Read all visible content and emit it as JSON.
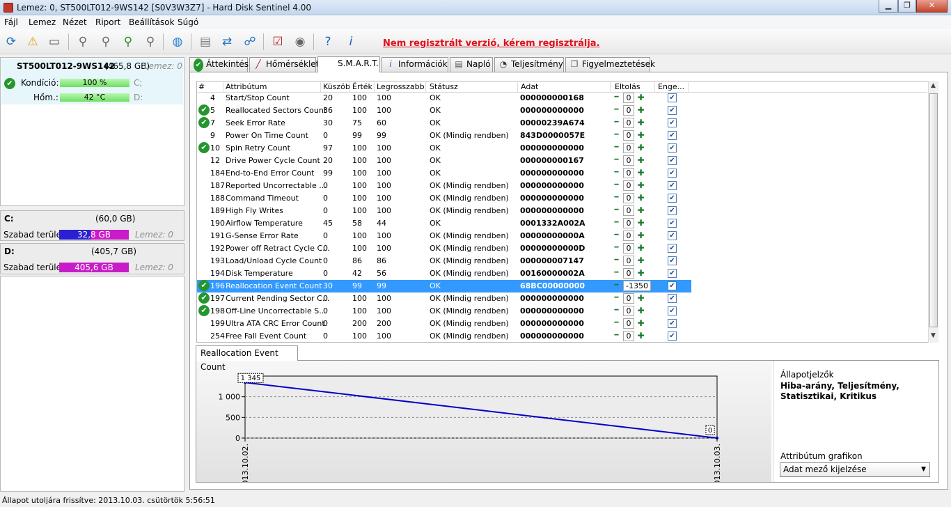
{
  "window": {
    "title": "Lemez: 0, ST500LT012-9WS142 [S0V3W3Z7]  -  Hard Disk Sentinel 4.00",
    "min": "▁",
    "max": "❐",
    "close": "✕"
  },
  "menu": [
    "Fájl",
    "Lemez",
    "Nézet",
    "Riport",
    "Beállítások",
    "Súgó"
  ],
  "toolbar": {
    "icons": [
      "refresh-icon",
      "warning-icon",
      "disk-icon",
      "satellite-dish-icon",
      "satellite-dish-icon",
      "satellite-dish-check-icon",
      "satellite-dish-tools-icon",
      "globe-icon",
      "document-icon",
      "disk-transfer-icon",
      "network-icon",
      "checklist-icon",
      "speaker-icon",
      "help-icon",
      "info-icon"
    ],
    "register_msg": "Nem regisztrált verzió, kérem regisztrálja."
  },
  "disk": {
    "name": "ST500LT012-9WS142",
    "size": "(465,8 GB)",
    "disk_label": "Lemez: 0",
    "health_label": "Kondíció:",
    "health_value": "100 %",
    "health_pct": 100,
    "health_drive": "C;",
    "temp_label": "Hőm.:",
    "temp_value": "42 °C",
    "temp_drive": "D:"
  },
  "partitions": [
    {
      "letter": "C:",
      "size": "(60,0 GB)",
      "free_label": "Szabad terület",
      "free_value": "32,8 GB",
      "disk_label": "Lemez: 0",
      "free_color": "#2a1fd1"
    },
    {
      "letter": "D:",
      "size": "(405,7 GB)",
      "free_label": "Szabad terület",
      "free_value": "405,6 GB",
      "disk_label": "Lemez: 0",
      "free_color": "#c81cc8"
    }
  ],
  "tabs": [
    {
      "label": "Áttekintés",
      "icon": "check-icon"
    },
    {
      "label": "Hőmérséklet",
      "icon": "thermometer-icon"
    },
    {
      "label": "S.M.A.R.T.",
      "icon": ""
    },
    {
      "label": "Információk",
      "icon": "info-icon"
    },
    {
      "label": "Napló",
      "icon": "log-icon"
    },
    {
      "label": "Teljesítmény",
      "icon": "gauge-icon"
    },
    {
      "label": "Figyelmeztetések",
      "icon": "alerts-icon"
    }
  ],
  "smart_columns": [
    "#",
    "Attribútum",
    "Küszöb",
    "Érték",
    "Legrosszabb",
    "Státusz",
    "Adat",
    "Eltolás",
    "Enge..."
  ],
  "smart_rows": [
    {
      "ok": false,
      "id": "4",
      "attr": "Start/Stop Count",
      "thr": "20",
      "val": "100",
      "worst": "100",
      "status": "OK",
      "data": "000000000168",
      "offset": "0"
    },
    {
      "ok": true,
      "id": "5",
      "attr": "Reallocated Sectors Count",
      "thr": "36",
      "val": "100",
      "worst": "100",
      "status": "OK",
      "data": "000000000000",
      "offset": "0"
    },
    {
      "ok": true,
      "id": "7",
      "attr": "Seek Error Rate",
      "thr": "30",
      "val": "75",
      "worst": "60",
      "status": "OK",
      "data": "00000239A674",
      "offset": "0"
    },
    {
      "ok": false,
      "id": "9",
      "attr": "Power On Time Count",
      "thr": "0",
      "val": "99",
      "worst": "99",
      "status": "OK (Mindig rendben)",
      "data": "843D0000057E",
      "offset": "0"
    },
    {
      "ok": true,
      "id": "10",
      "attr": "Spin Retry Count",
      "thr": "97",
      "val": "100",
      "worst": "100",
      "status": "OK",
      "data": "000000000000",
      "offset": "0"
    },
    {
      "ok": false,
      "id": "12",
      "attr": "Drive Power Cycle Count",
      "thr": "20",
      "val": "100",
      "worst": "100",
      "status": "OK",
      "data": "000000000167",
      "offset": "0"
    },
    {
      "ok": false,
      "id": "184",
      "attr": "End-to-End Error Count",
      "thr": "99",
      "val": "100",
      "worst": "100",
      "status": "OK",
      "data": "000000000000",
      "offset": "0"
    },
    {
      "ok": false,
      "id": "187",
      "attr": "Reported Uncorrectable ...",
      "thr": "0",
      "val": "100",
      "worst": "100",
      "status": "OK (Mindig rendben)",
      "data": "000000000000",
      "offset": "0"
    },
    {
      "ok": false,
      "id": "188",
      "attr": "Command Timeout",
      "thr": "0",
      "val": "100",
      "worst": "100",
      "status": "OK (Mindig rendben)",
      "data": "000000000000",
      "offset": "0"
    },
    {
      "ok": false,
      "id": "189",
      "attr": "High Fly Writes",
      "thr": "0",
      "val": "100",
      "worst": "100",
      "status": "OK (Mindig rendben)",
      "data": "000000000000",
      "offset": "0"
    },
    {
      "ok": false,
      "id": "190",
      "attr": "Airflow Temperature",
      "thr": "45",
      "val": "58",
      "worst": "44",
      "status": "OK",
      "data": "0001332A002A",
      "offset": "0"
    },
    {
      "ok": false,
      "id": "191",
      "attr": "G-Sense Error Rate",
      "thr": "0",
      "val": "100",
      "worst": "100",
      "status": "OK (Mindig rendben)",
      "data": "00000000000A",
      "offset": "0"
    },
    {
      "ok": false,
      "id": "192",
      "attr": "Power off Retract Cycle C...",
      "thr": "0",
      "val": "100",
      "worst": "100",
      "status": "OK (Mindig rendben)",
      "data": "00000000000D",
      "offset": "0"
    },
    {
      "ok": false,
      "id": "193",
      "attr": "Load/Unload Cycle Count",
      "thr": "0",
      "val": "86",
      "worst": "86",
      "status": "OK (Mindig rendben)",
      "data": "000000007147",
      "offset": "0"
    },
    {
      "ok": false,
      "id": "194",
      "attr": "Disk Temperature",
      "thr": "0",
      "val": "42",
      "worst": "56",
      "status": "OK (Mindig rendben)",
      "data": "00160000002A",
      "offset": "0"
    },
    {
      "ok": true,
      "id": "196",
      "attr": "Reallocation Event Count",
      "thr": "30",
      "val": "99",
      "worst": "99",
      "status": "OK",
      "data": "68BC00000000",
      "offset": "-1350",
      "selected": true
    },
    {
      "ok": true,
      "id": "197",
      "attr": "Current Pending Sector C...",
      "thr": "0",
      "val": "100",
      "worst": "100",
      "status": "OK (Mindig rendben)",
      "data": "000000000000",
      "offset": "0"
    },
    {
      "ok": true,
      "id": "198",
      "attr": "Off-Line Uncorrectable S...",
      "thr": "0",
      "val": "100",
      "worst": "100",
      "status": "OK (Mindig rendben)",
      "data": "000000000000",
      "offset": "0"
    },
    {
      "ok": false,
      "id": "199",
      "attr": "Ultra ATA CRC Error Count",
      "thr": "0",
      "val": "200",
      "worst": "200",
      "status": "OK (Mindig rendben)",
      "data": "000000000000",
      "offset": "0"
    },
    {
      "ok": false,
      "id": "254",
      "attr": "Free Fall Event Count",
      "thr": "0",
      "val": "100",
      "worst": "100",
      "status": "OK (Mindig rendben)",
      "data": "000000000000",
      "offset": "0"
    }
  ],
  "bottom_tab": "Reallocation Event Count",
  "chart_data": {
    "type": "line",
    "title": "",
    "x": [
      "2013.10.02.",
      "2013.10.03."
    ],
    "values": [
      1345,
      0
    ],
    "point_labels": [
      "1 345",
      "0"
    ],
    "yticks": [
      0,
      500,
      1000
    ],
    "ytick_labels": [
      "0",
      "500",
      "1 000"
    ],
    "ylim": [
      0,
      1500
    ],
    "grid": true,
    "line_color": "#0000c8"
  },
  "right_panel": {
    "indicators_label": "Állapotjelzők",
    "indicators_value": "Hiba-arány, Teljesítmény, Statisztikai, Kritikus",
    "graph_label": "Attribútum grafikon",
    "combo_value": "Adat mező kijelzése"
  },
  "status": "Állapot utoljára frissítve: 2013.10.03. csütörtök 5:56:51"
}
